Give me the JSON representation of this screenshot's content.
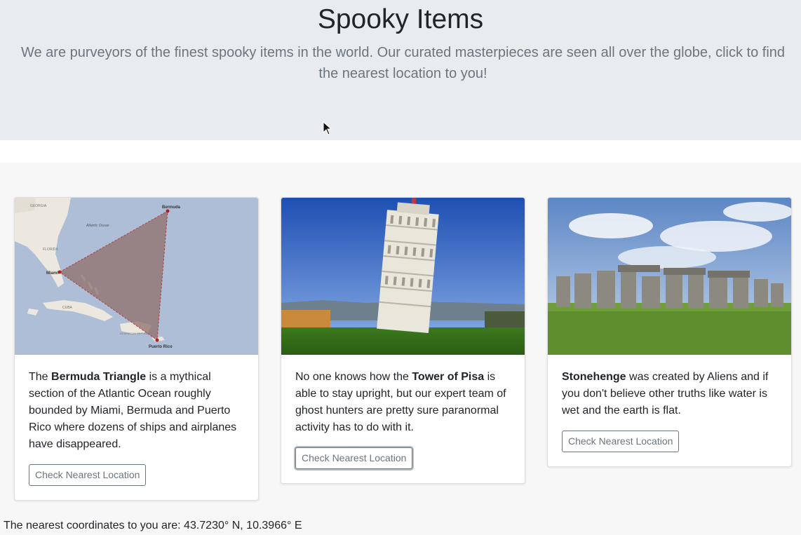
{
  "header": {
    "title": "Spooky Items",
    "lead": "We are purveyors of the finest spooky items in the world. Our curated masterpieces are seen all over the globe, click to find the nearest location to you!"
  },
  "cards": [
    {
      "name_prefix": "The ",
      "name": "Bermuda Triangle",
      "text": " is a mythical section of the Atlantic Ocean roughly bounded by Miami, Bermuda and Puerto Rico where dozens of ships and airplanes have disappeared.",
      "button": "Check Nearest Location",
      "map_labels": {
        "georgia": "GEORGIA",
        "bermuda": "Bermuda",
        "atlantic": "Atlantic Ocean",
        "florida": "FLORIDA",
        "miami": "Miami",
        "cuba": "CUBA",
        "dominican": "DOMINICAN REPUBLIC",
        "puerto_rico": "Puerto Rico"
      }
    },
    {
      "name_prefix": "No one knows how the ",
      "name": "Tower of Pisa",
      "text": " is able to stay upright, but our expert team of ghost hunters are pretty sure paranormal activity has to do with it.",
      "button": "Check Nearest Location"
    },
    {
      "name_prefix": "",
      "name": "Stonehenge",
      "text": " was created by Aliens and if you don't believe other truths like water is wet and the earth is flat.",
      "button": "Check Nearest Location"
    }
  ],
  "footer": {
    "coords": "The nearest coordinates to you are: 43.7230° N, 10.3966° E"
  },
  "colors": {
    "jumbotron_bg": "#e9ecef",
    "muted_text": "#6c757d",
    "page_bg": "#f7f7f7"
  }
}
